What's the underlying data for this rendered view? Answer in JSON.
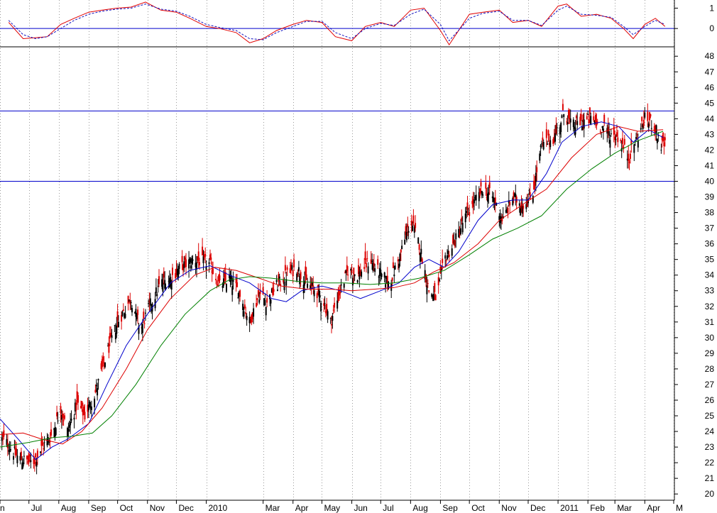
{
  "chart_data": [
    {
      "type": "line",
      "panel": "oscillator",
      "y_ticks": [
        1,
        0
      ],
      "ylim": [
        -0.9,
        1.4
      ],
      "reference_lines": [
        0
      ],
      "colors": {
        "line": "#e00000",
        "signal": "#1010c0",
        "reference": "#0000cc"
      },
      "series": [
        {
          "style": "solid",
          "x": [
            "2009-06-10",
            "2009-06-25",
            "2009-07-08",
            "2009-07-20",
            "2009-08-03",
            "2009-08-17",
            "2009-09-01",
            "2009-09-15",
            "2009-09-30",
            "2009-10-15",
            "2009-10-30",
            "2009-11-15",
            "2009-12-01",
            "2009-12-15",
            "2010-01-01",
            "2010-01-15",
            "2010-02-01",
            "2010-02-15",
            "2010-03-01",
            "2010-03-15",
            "2010-04-01",
            "2010-04-15",
            "2010-05-01",
            "2010-05-15",
            "2010-06-01",
            "2010-06-15",
            "2010-07-01",
            "2010-07-15",
            "2010-08-01",
            "2010-08-15",
            "2010-09-01",
            "2010-09-10",
            "2010-10-01",
            "2010-10-15",
            "2010-11-01",
            "2010-11-15",
            "2010-12-01",
            "2010-12-15",
            "2011-01-01",
            "2011-01-10",
            "2011-01-25",
            "2011-02-10",
            "2011-02-25",
            "2011-03-10",
            "2011-03-20",
            "2011-04-01",
            "2011-04-12",
            "2011-04-22"
          ],
          "values": [
            0.3,
            -0.5,
            -0.45,
            -0.4,
            0.2,
            0.5,
            0.8,
            0.9,
            1.0,
            1.05,
            1.3,
            0.9,
            0.8,
            0.5,
            0.1,
            0.0,
            -0.2,
            -0.7,
            -0.5,
            -0.1,
            0.2,
            0.4,
            0.3,
            -0.4,
            -0.6,
            0.1,
            0.3,
            0.1,
            0.9,
            1.0,
            -0.1,
            -0.8,
            0.7,
            0.8,
            0.9,
            0.3,
            0.4,
            0.1,
            1.1,
            1.2,
            0.6,
            0.7,
            0.5,
            0.0,
            -0.5,
            0.2,
            0.5,
            0.1
          ]
        },
        {
          "style": "dashed",
          "x": [
            "2009-06-10",
            "2009-06-25",
            "2009-07-08",
            "2009-07-20",
            "2009-08-03",
            "2009-08-17",
            "2009-09-01",
            "2009-09-15",
            "2009-09-30",
            "2009-10-15",
            "2009-10-30",
            "2009-11-15",
            "2009-12-01",
            "2009-12-15",
            "2010-01-01",
            "2010-01-15",
            "2010-02-01",
            "2010-02-15",
            "2010-03-01",
            "2010-03-15",
            "2010-04-01",
            "2010-04-15",
            "2010-05-01",
            "2010-05-15",
            "2010-06-01",
            "2010-06-15",
            "2010-07-01",
            "2010-07-15",
            "2010-08-01",
            "2010-08-15",
            "2010-09-01",
            "2010-09-10",
            "2010-10-01",
            "2010-10-15",
            "2010-11-01",
            "2010-11-15",
            "2010-12-01",
            "2010-12-15",
            "2011-01-01",
            "2011-01-10",
            "2011-01-25",
            "2011-02-10",
            "2011-02-25",
            "2011-03-10",
            "2011-03-20",
            "2011-04-01",
            "2011-04-12",
            "2011-04-22"
          ],
          "values": [
            0.4,
            -0.3,
            -0.5,
            -0.4,
            0.0,
            0.4,
            0.7,
            0.85,
            0.95,
            1.0,
            1.2,
            0.95,
            0.85,
            0.6,
            0.2,
            0.05,
            -0.1,
            -0.5,
            -0.55,
            -0.2,
            0.1,
            0.35,
            0.35,
            -0.2,
            -0.5,
            0.0,
            0.25,
            0.15,
            0.7,
            0.95,
            0.2,
            -0.6,
            0.5,
            0.75,
            0.85,
            0.4,
            0.4,
            0.15,
            0.9,
            1.1,
            0.7,
            0.65,
            0.55,
            0.1,
            -0.3,
            0.1,
            0.4,
            0.2
          ]
        }
      ]
    },
    {
      "type": "candlestick",
      "panel": "price",
      "ylim": [
        19.6,
        48.6
      ],
      "y_ticks": [
        48,
        47,
        46,
        45,
        44,
        43,
        42,
        41,
        40,
        39,
        38,
        37,
        36,
        35,
        34,
        33,
        32,
        31,
        30,
        29,
        28,
        27,
        26,
        25,
        24,
        23,
        22,
        21,
        20
      ],
      "x_tick_labels": [
        {
          "label": "n",
          "date": "2009-06-01"
        },
        {
          "label": "Jul",
          "date": "2009-07-01"
        },
        {
          "label": "Aug",
          "date": "2009-08-01"
        },
        {
          "label": "Sep",
          "date": "2009-09-01"
        },
        {
          "label": "Oct",
          "date": "2009-10-01"
        },
        {
          "label": "Nov",
          "date": "2009-11-01"
        },
        {
          "label": "Dec",
          "date": "2009-12-01"
        },
        {
          "label": "2010",
          "date": "2010-01-01"
        },
        {
          "label": "Mar",
          "date": "2010-03-01"
        },
        {
          "label": "Apr",
          "date": "2010-04-01"
        },
        {
          "label": "May",
          "date": "2010-05-01"
        },
        {
          "label": "Jun",
          "date": "2010-06-01"
        },
        {
          "label": "Jul",
          "date": "2010-07-01"
        },
        {
          "label": "Aug",
          "date": "2010-08-01"
        },
        {
          "label": "Sep",
          "date": "2010-09-01"
        },
        {
          "label": "Oct",
          "date": "2010-10-01"
        },
        {
          "label": "Nov",
          "date": "2010-11-01"
        },
        {
          "label": "Dec",
          "date": "2010-12-01"
        },
        {
          "label": "2011",
          "date": "2011-01-01"
        },
        {
          "label": "Feb",
          "date": "2011-02-01"
        },
        {
          "label": "Mar",
          "date": "2011-03-01"
        },
        {
          "label": "Apr",
          "date": "2011-04-01"
        },
        {
          "label": "M",
          "date": "2011-05-01"
        }
      ],
      "x_range": [
        "2009-06-01",
        "2011-05-01"
      ],
      "grid": "vertical dotted",
      "reference_lines": [
        44.5,
        40
      ],
      "colors": {
        "up": "#000000",
        "down": "#dd0000",
        "ma_short": "#0000cc",
        "ma_mid": "#dd0000",
        "ma_long": "#008000",
        "reference": "#0000cc"
      },
      "price_path": {
        "x": [
          "2009-06-05",
          "2009-06-20",
          "2009-07-05",
          "2009-07-15",
          "2009-07-25",
          "2009-08-03",
          "2009-08-10",
          "2009-08-20",
          "2009-08-28",
          "2009-09-08",
          "2009-09-20",
          "2009-10-01",
          "2009-10-15",
          "2009-10-25",
          "2009-11-03",
          "2009-11-15",
          "2009-11-25",
          "2009-12-05",
          "2009-12-20",
          "2010-01-05",
          "2010-01-15",
          "2010-01-25",
          "2010-02-05",
          "2010-02-15",
          "2010-02-25",
          "2010-03-05",
          "2010-03-15",
          "2010-03-25",
          "2010-04-05",
          "2010-04-15",
          "2010-04-25",
          "2010-05-03",
          "2010-05-10",
          "2010-05-20",
          "2010-05-28",
          "2010-06-08",
          "2010-06-20",
          "2010-07-01",
          "2010-07-10",
          "2010-07-20",
          "2010-08-01",
          "2010-08-10",
          "2010-08-20",
          "2010-08-28",
          "2010-09-05",
          "2010-09-15",
          "2010-09-25",
          "2010-10-05",
          "2010-10-15",
          "2010-10-25",
          "2010-11-05",
          "2010-11-15",
          "2010-11-25",
          "2010-12-05",
          "2010-12-15",
          "2010-12-28",
          "2011-01-08",
          "2011-01-15",
          "2011-01-25",
          "2011-02-05",
          "2011-02-15",
          "2011-02-25",
          "2011-03-05",
          "2011-03-15",
          "2011-03-22",
          "2011-04-01",
          "2011-04-10",
          "2011-04-18"
        ],
        "values": [
          23.5,
          22.3,
          22.0,
          23.0,
          23.8,
          25.5,
          24.0,
          25.8,
          25.0,
          26.5,
          29.0,
          31.0,
          32.5,
          30.5,
          32.0,
          33.5,
          33.8,
          34.5,
          35.0,
          34.7,
          33.3,
          33.8,
          32.8,
          31.0,
          32.8,
          32.3,
          33.3,
          34.0,
          34.5,
          33.5,
          33.0,
          32.3,
          31.0,
          33.0,
          34.3,
          34.0,
          35.0,
          34.0,
          33.5,
          35.0,
          37.5,
          36.0,
          33.0,
          32.5,
          35.0,
          36.0,
          37.5,
          38.5,
          39.5,
          39.0,
          37.5,
          39.0,
          38.5,
          39.0,
          42.3,
          42.8,
          44.5,
          43.5,
          43.8,
          44.0,
          43.5,
          43.0,
          42.8,
          41.5,
          42.5,
          44.0,
          43.7,
          42.3
        ]
      },
      "moving_averages": [
        {
          "color": "blue",
          "x": [
            "2009-06-01",
            "2009-06-20",
            "2009-07-08",
            "2009-07-25",
            "2009-08-10",
            "2009-09-01",
            "2009-09-20",
            "2009-10-10",
            "2009-11-01",
            "2009-11-25",
            "2009-12-15",
            "2010-01-05",
            "2010-01-25",
            "2010-02-15",
            "2010-03-10",
            "2010-03-25",
            "2010-04-10",
            "2010-05-01",
            "2010-05-20",
            "2010-06-10",
            "2010-07-01",
            "2010-07-20",
            "2010-08-05",
            "2010-08-20",
            "2010-09-05",
            "2010-09-20",
            "2010-10-10",
            "2010-10-25",
            "2010-11-15",
            "2010-12-01",
            "2010-12-20",
            "2011-01-05",
            "2011-01-25",
            "2011-02-15",
            "2011-03-05",
            "2011-03-20",
            "2011-04-05",
            "2011-04-20"
          ],
          "values": [
            24.8,
            23.5,
            22.2,
            23.0,
            23.5,
            24.5,
            27.0,
            29.5,
            31.5,
            33.5,
            34.3,
            34.6,
            34.0,
            33.5,
            32.5,
            32.3,
            33.0,
            33.3,
            33.0,
            32.5,
            33.0,
            33.5,
            34.5,
            35.0,
            34.5,
            35.5,
            37.5,
            38.5,
            38.8,
            38.8,
            40.5,
            42.5,
            43.5,
            43.8,
            43.5,
            42.5,
            43.3,
            42.8
          ]
        },
        {
          "color": "red",
          "x": [
            "2009-06-01",
            "2009-06-25",
            "2009-07-15",
            "2009-08-05",
            "2009-08-25",
            "2009-09-15",
            "2009-10-10",
            "2009-11-01",
            "2009-11-25",
            "2009-12-20",
            "2010-01-10",
            "2010-02-01",
            "2010-02-25",
            "2010-03-20",
            "2010-04-15",
            "2010-05-10",
            "2010-06-01",
            "2010-06-25",
            "2010-07-15",
            "2010-08-05",
            "2010-08-25",
            "2010-09-15",
            "2010-10-10",
            "2010-11-01",
            "2010-11-25",
            "2010-12-20",
            "2011-01-15",
            "2011-02-10",
            "2011-03-05",
            "2011-03-25",
            "2011-04-20"
          ],
          "values": [
            23.8,
            23.9,
            23.5,
            23.2,
            24.0,
            25.5,
            28.0,
            30.5,
            32.5,
            34.0,
            34.5,
            34.3,
            33.8,
            33.3,
            33.1,
            33.1,
            33.0,
            33.1,
            33.2,
            33.5,
            34.2,
            34.8,
            36.0,
            37.5,
            38.5,
            39.5,
            41.5,
            43.0,
            43.5,
            43.2,
            43.3
          ]
        },
        {
          "color": "green",
          "x": [
            "2009-06-01",
            "2009-07-01",
            "2009-07-25",
            "2009-08-15",
            "2009-09-05",
            "2009-09-25",
            "2009-10-20",
            "2009-11-15",
            "2009-12-10",
            "2010-01-05",
            "2010-01-25",
            "2010-02-15",
            "2010-03-10",
            "2010-04-05",
            "2010-05-01",
            "2010-05-25",
            "2010-06-20",
            "2010-07-15",
            "2010-08-10",
            "2010-09-05",
            "2010-10-01",
            "2010-10-25",
            "2010-11-20",
            "2010-12-15",
            "2011-01-10",
            "2011-02-05",
            "2011-03-01",
            "2011-03-25",
            "2011-04-20"
          ],
          "values": [
            23.0,
            23.3,
            23.6,
            23.7,
            23.9,
            25.0,
            27.0,
            29.5,
            31.5,
            33.0,
            33.7,
            33.9,
            33.8,
            33.6,
            33.5,
            33.5,
            33.4,
            33.5,
            33.8,
            34.3,
            35.3,
            36.3,
            37.0,
            37.8,
            39.5,
            40.8,
            41.8,
            42.6,
            43.2
          ]
        }
      ]
    }
  ]
}
